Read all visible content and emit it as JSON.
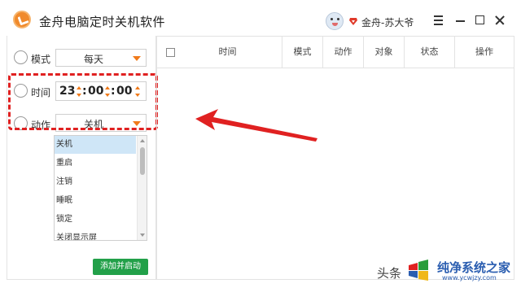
{
  "window": {
    "title": "金舟电脑定时关机软件",
    "user_name": "金舟-苏大爷"
  },
  "table": {
    "columns": [
      "时间",
      "模式",
      "动作",
      "对象",
      "状态",
      "操作"
    ]
  },
  "form": {
    "mode_label": "模式",
    "mode_value": "每天",
    "time_label": "时间",
    "time_hour": "23",
    "time_minute": "00",
    "time_second": "00",
    "time_separator": ":",
    "action_label": "动作",
    "action_value": "关机"
  },
  "dropdown": {
    "options": [
      "关机",
      "重启",
      "注销",
      "睡眠",
      "锁定",
      "关闭显示屏"
    ],
    "selected": "关机"
  },
  "add_button_label": "添加并启动",
  "watermark": {
    "left_text": "头条",
    "brand": "纯净系统之家",
    "url": "www.ycwjzy.com"
  },
  "colors": {
    "accent_orange": "#f07a1a",
    "annotation_red": "#e02121",
    "button_green": "#22a049"
  }
}
